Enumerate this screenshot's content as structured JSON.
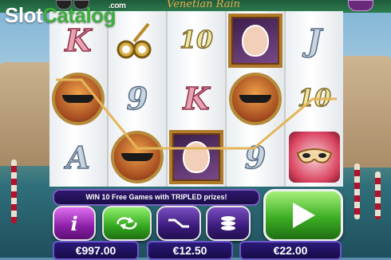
{
  "watermark": {
    "slot": "Slot",
    "catalog": "Catalog",
    "com": ".com"
  },
  "game_title": "Venetian Rain",
  "reels": [
    [
      "K",
      "binoculars",
      "K",
      "gondola",
      "A"
    ],
    [
      "binoculars",
      "9",
      "gondola"
    ],
    [
      "10",
      "K",
      "portrait"
    ],
    [
      "portrait",
      "gondola",
      "9"
    ],
    [
      "J",
      "10",
      "mask"
    ]
  ],
  "grid": [
    [
      {
        "t": "letter",
        "v": "K",
        "c": "red"
      },
      {
        "t": "binoculars"
      },
      {
        "t": "letter",
        "v": "10",
        "c": "yellow"
      },
      {
        "t": "portrait"
      },
      {
        "t": "letter",
        "v": "J",
        "c": "blue"
      }
    ],
    [
      {
        "t": "gondola"
      },
      {
        "t": "letter",
        "v": "9",
        "c": "blue"
      },
      {
        "t": "letter",
        "v": "K",
        "c": "red"
      },
      {
        "t": "gondola"
      },
      {
        "t": "letter",
        "v": "10",
        "c": "yellow"
      }
    ],
    [
      {
        "t": "letter",
        "v": "A",
        "c": "blue"
      },
      {
        "t": "gondola"
      },
      {
        "t": "portrait"
      },
      {
        "t": "letter",
        "v": "9",
        "c": "blue"
      },
      {
        "t": "mask"
      }
    ]
  ],
  "message": "WIN 10 Free Games with TRIPLED prizes!",
  "buttons": {
    "info": "i",
    "autoplay": "autoplay-icon",
    "lines": "lines-icon",
    "bet": "coins-icon",
    "spin": "play-icon"
  },
  "balance": "€997.00",
  "bet": "€12.50",
  "win": "€22.00",
  "colors": {
    "accent_green": "#3cae24",
    "accent_purple": "#8a1fa6",
    "panel_blue": "#1a0d46"
  }
}
